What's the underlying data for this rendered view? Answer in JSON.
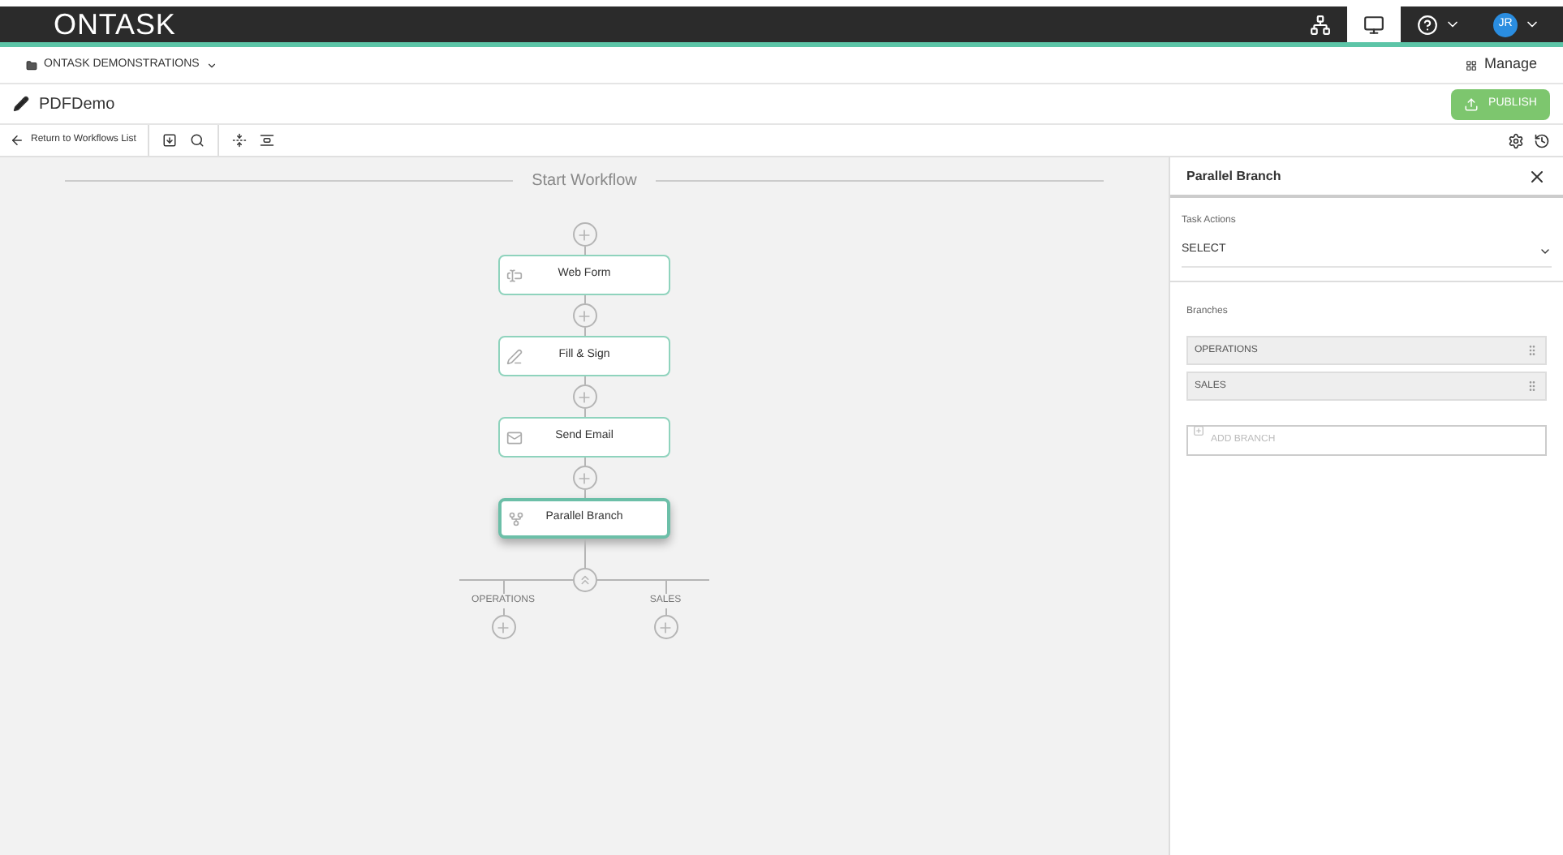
{
  "header": {
    "logo": "ONTASK",
    "nav_icons": [
      {
        "kind": "sitemap",
        "selected": false
      },
      {
        "kind": "monitor",
        "selected": true
      },
      {
        "kind": "help",
        "selected": false
      }
    ],
    "avatar": "JR"
  },
  "org_bar": {
    "organization": "ONTASK DEMONSTRATIONS",
    "manage": "Manage"
  },
  "workflow": {
    "title": "PDFDemo",
    "publish": "PUBLISH"
  },
  "toolbar": {
    "back": "Return to Workflows List"
  },
  "canvas": {
    "title": "Start Workflow",
    "steps": [
      {
        "kind": "form",
        "label": "Web Form",
        "selected": false
      },
      {
        "kind": "sign",
        "label": "Fill & Sign",
        "selected": false
      },
      {
        "kind": "email",
        "label": "Send Email",
        "selected": false
      },
      {
        "kind": "branch",
        "label": "Parallel Branch",
        "selected": true
      }
    ],
    "branches": [
      "OPERATIONS",
      "SALES"
    ]
  },
  "panel": {
    "title": "Parallel Branch",
    "task_actions_label": "Task Actions",
    "task_actions_value": "SELECT",
    "branches_label": "Branches",
    "branches": [
      "OPERATIONS",
      "SALES"
    ],
    "add_branch_placeholder": "ADD BRANCH"
  }
}
